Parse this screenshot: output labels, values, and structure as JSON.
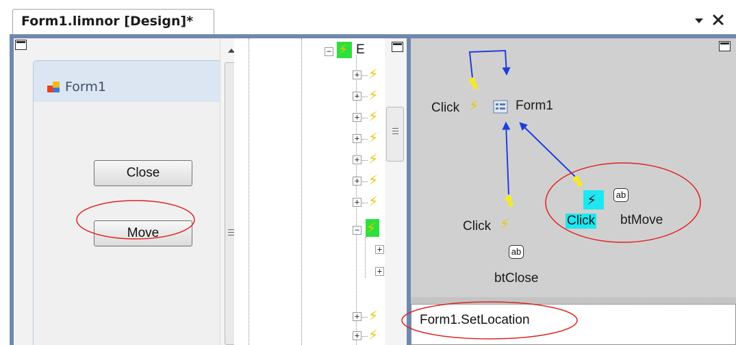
{
  "tab": {
    "title": "Form1.limnor [Design]*"
  },
  "window_controls": {
    "dropdown_icon": "chevron-down-icon",
    "close_icon": "close-icon"
  },
  "form_preview": {
    "title": "Form1",
    "buttons": [
      {
        "label": "Close"
      },
      {
        "label": "Move"
      }
    ]
  },
  "event_tree": {
    "root_label_fragment": "E"
  },
  "diagram": {
    "nodes": {
      "form": {
        "label": "Form1"
      },
      "form_event": {
        "label": "Click"
      },
      "btclose_event": {
        "label": "Click"
      },
      "btclose": {
        "label": "btClose",
        "badge": "ab"
      },
      "btmove_event": {
        "label": "Click"
      },
      "btmove": {
        "label": "btMove",
        "badge": "ab"
      }
    },
    "colors": {
      "arrow": "#1f3ddc",
      "highlight": "#1de7f0",
      "annotation_ellipse": "#e02020",
      "bolt": "#e8c800"
    }
  },
  "method_panel": {
    "selected": "Form1.SetLocation"
  }
}
